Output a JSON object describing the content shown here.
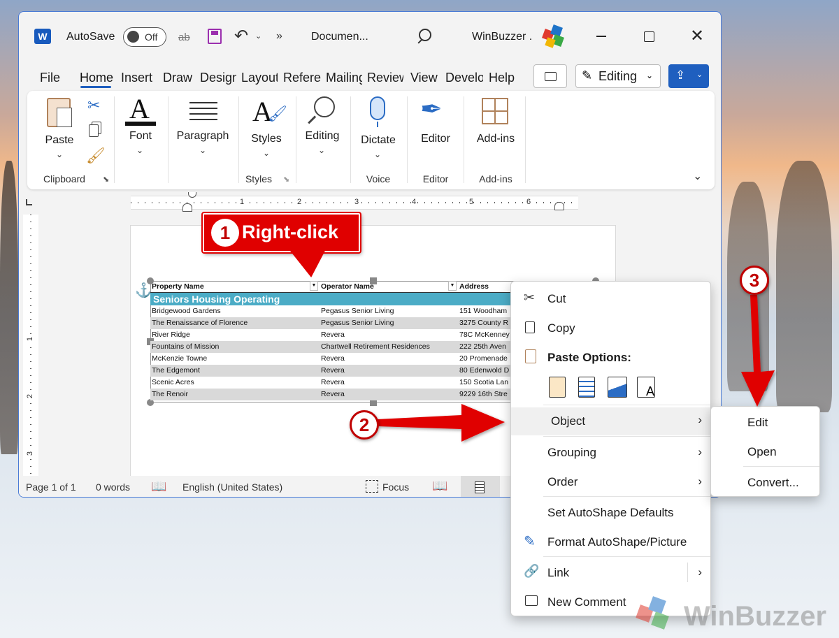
{
  "titlebar": {
    "autosave_label": "AutoSave",
    "autosave_state": "Off",
    "doc_title": "Documen...",
    "account": "WinBuzzer ."
  },
  "tabs": [
    "File",
    "Home",
    "Insert",
    "Draw",
    "Design",
    "Layout",
    "References",
    "Mailings",
    "Review",
    "View",
    "Developer",
    "Help"
  ],
  "editing_mode": "Editing",
  "ribbon": {
    "paste": "Paste",
    "clipboard_group": "Clipboard",
    "font": "Font",
    "paragraph": "Paragraph",
    "styles": "Styles",
    "styles_group": "Styles",
    "editing": "Editing",
    "dictate": "Dictate",
    "voice_group": "Voice",
    "editor": "Editor",
    "editor_group": "Editor",
    "addins": "Add-ins",
    "addins_group": "Add-ins"
  },
  "ruler_numbers": [
    "1",
    "2",
    "3",
    "4",
    "5",
    "6"
  ],
  "vruler_numbers": [
    "1",
    "2",
    "3"
  ],
  "table": {
    "headers": [
      "Property Name",
      "Operator Name",
      "Address"
    ],
    "section": "Seniors Housing Operating",
    "rows": [
      [
        "Bridgewood Gardens",
        "Pegasus Senior Living",
        "151 Woodham"
      ],
      [
        "The Renaissance of Florence",
        "Pegasus Senior Living",
        "3275 County R"
      ],
      [
        "River Ridge",
        "Revera",
        "78C McKenney"
      ],
      [
        "Fountains of Mission",
        "Chartwell Retirement Residences",
        "222 25th Aven"
      ],
      [
        "McKenzie Towne",
        "Revera",
        "20 Promenade"
      ],
      [
        "The Edgemont",
        "Revera",
        "80 Edenwold D"
      ],
      [
        "Scenic Acres",
        "Revera",
        "150 Scotia Lan"
      ],
      [
        "The Renoir",
        "Revera",
        "9229 16th Stre"
      ]
    ]
  },
  "status": {
    "page": "Page 1 of 1",
    "words": "0 words",
    "language": "English (United States)",
    "focus": "Focus"
  },
  "context_menu": {
    "cut": "Cut",
    "copy": "Copy",
    "paste_options": "Paste Options:",
    "object": "Object",
    "grouping": "Grouping",
    "order": "Order",
    "set_defaults": "Set AutoShape Defaults",
    "format": "Format AutoShape/Picture",
    "link": "Link",
    "new_comment": "New Comment"
  },
  "submenu": {
    "edit": "Edit",
    "open": "Open",
    "convert": "Convert..."
  },
  "annotations": {
    "step1": "1",
    "step1_text": "Right-click",
    "step2": "2",
    "step3": "3"
  },
  "watermark": "WinBuzzer",
  "colors": {
    "accent": "#1f5fbf",
    "callout": "#e00000",
    "table_header": "#4bacc6"
  }
}
